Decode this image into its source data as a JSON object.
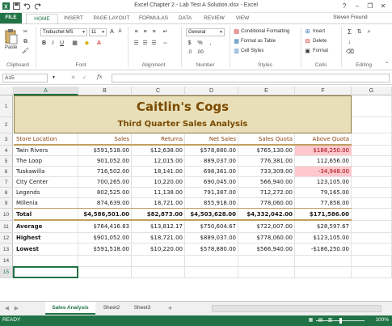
{
  "window": {
    "title": "Excel Chapter 2 - Lab Test A Solution.xlsx - Excel",
    "user": "Steven Freund",
    "help": "?",
    "minimize": "–",
    "restore": "❐",
    "close": "✕"
  },
  "ribbon_tabs": [
    "FILE",
    "HOME",
    "INSERT",
    "PAGE LAYOUT",
    "FORMULAS",
    "DATA",
    "REVIEW",
    "VIEW"
  ],
  "ribbon": {
    "paste": "Paste",
    "clipboard": "Clipboard",
    "font_name": "Trebuchet MS",
    "font_size": "11",
    "font_group": "Font",
    "alignment_group": "Alignment",
    "number_format": "General",
    "number_group": "Number",
    "currency": "$",
    "percent": "%",
    "comma": ",",
    "conditional_formatting": "Conditional Formatting",
    "format_as_table": "Format as Table",
    "cell_styles": "Cell Styles",
    "styles_group": "Styles",
    "insert": "Insert",
    "delete": "Delete",
    "format": "Format",
    "cells_group": "Cells",
    "editing_group": "Editing",
    "bold": "B",
    "italic": "I",
    "underline": "U"
  },
  "formula_bar": {
    "name_box": "A15",
    "fx": "fx",
    "formula": ""
  },
  "columns": [
    "A",
    "B",
    "C",
    "D",
    "E",
    "F",
    "G"
  ],
  "rows": [
    "1",
    "2",
    "3",
    "4",
    "5",
    "6",
    "7",
    "8",
    "9",
    "10",
    "11",
    "12",
    "13",
    "14",
    "15"
  ],
  "sheet": {
    "title": "Caitlin's Cogs",
    "subtitle": "Third Quarter Sales Analysis",
    "headers": [
      "Store Location",
      "Sales",
      "Returns",
      "Net Sales",
      "Sales Quota",
      "Above Quota"
    ],
    "data_rows": [
      [
        "Twin Rivers",
        "$591,518.00",
        "$12,638.00",
        "$578,880.00",
        "$765,130.00",
        "$186,250.00"
      ],
      [
        "The Loop",
        "901,052.00",
        "12,015.00",
        "889,037.00",
        "776,381.00",
        "112,656.00"
      ],
      [
        "Tuskawilla",
        "716,502.00",
        "18,141.00",
        "698,361.00",
        "733,309.00",
        "-34,948.00"
      ],
      [
        "City Center",
        "700,265.00",
        "10,220.00",
        "690,045.00",
        "566,940.00",
        "123,105.00"
      ],
      [
        "Legends",
        "802,525.00",
        "11,138.00",
        "791,387.00",
        "712,272.00",
        "79,165.00"
      ],
      [
        "Millenia",
        "874,639.00",
        "18,721.00",
        "855,918.00",
        "778,060.00",
        "77,858.00"
      ]
    ],
    "total_row": [
      "Total",
      "$4,586,501.00",
      "$82,873.00",
      "$4,503,628.00",
      "$4,332,042.00",
      "$171,586.00"
    ],
    "stat_rows": [
      [
        "Average",
        "$764,416.83",
        "$13,812.17",
        "$750,604.67",
        "$722,007.00",
        "$28,597.67"
      ],
      [
        "Highest",
        "$901,052.00",
        "$18,721.00",
        "$889,037.00",
        "$778,060.00",
        "$123,105.00"
      ],
      [
        "Lowest",
        "$591,518.00",
        "$10,220.00",
        "$578,880.00",
        "$566,940.00",
        "-$186,250.00"
      ]
    ]
  },
  "sheet_tabs": [
    "Sales Analysis",
    "Sheet2",
    "Sheet3"
  ],
  "add_sheet": "+",
  "status": {
    "ready": "READY",
    "zoom": "100%"
  },
  "colors": {
    "accent": "#217346",
    "title_fill": "#e8dfb8",
    "title_text": "#7a4a00",
    "header_text": "#8b4513",
    "highlight_fill": "#ffc7ce"
  }
}
